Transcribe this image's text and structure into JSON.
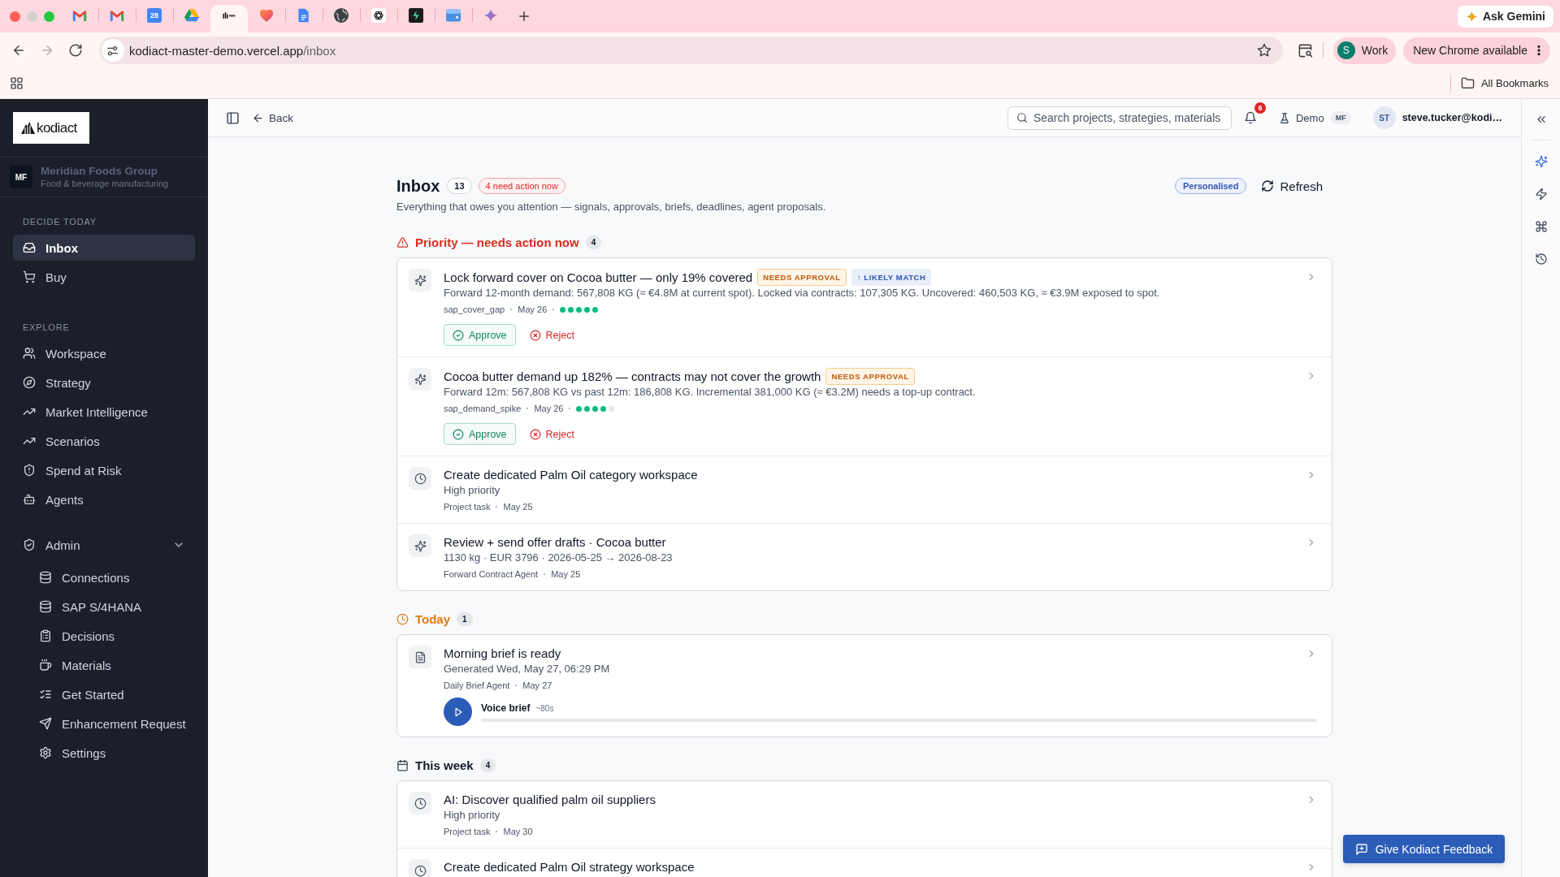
{
  "browser": {
    "tabs": [
      {
        "kind": "mail",
        "selected": false
      },
      {
        "kind": "mail",
        "selected": false
      },
      {
        "kind": "calendar",
        "date": "28",
        "selected": false
      },
      {
        "kind": "drive",
        "selected": false
      },
      {
        "kind": "kodiact",
        "selected": true
      },
      {
        "kind": "heart",
        "selected": false
      },
      {
        "kind": "doc",
        "selected": false
      },
      {
        "kind": "globe",
        "selected": false
      },
      {
        "kind": "knot",
        "selected": false
      },
      {
        "kind": "bolt",
        "selected": false
      },
      {
        "kind": "window",
        "selected": false
      },
      {
        "kind": "sparkle",
        "selected": false
      }
    ],
    "ask_button": "Ask Gemini",
    "nav": [
      {
        "kind": "back",
        "disabled": false
      },
      {
        "kind": "forward",
        "disabled": true
      },
      {
        "kind": "reload",
        "disabled": false
      }
    ],
    "address": {
      "host": "kodiact-master-demo.vercel.app",
      "path": "/inbox"
    },
    "profile": {
      "initial": "S",
      "label": "Work"
    },
    "update_button": "New Chrome available",
    "bookmarks_folder": "All Bookmarks"
  },
  "sidebar": {
    "logo": "kodiact",
    "org": {
      "initials": "MF",
      "name": "Meridian Foods Group",
      "subtitle": "Food & beverage manufacturing"
    },
    "sections": [
      {
        "label": "DECIDE TODAY",
        "items": [
          {
            "label": "Inbox",
            "kind": "inbox",
            "selected": true
          },
          {
            "label": "Buy",
            "kind": "cart",
            "selected": false
          }
        ]
      },
      {
        "label": "EXPLORE",
        "items": [
          {
            "label": "Workspace",
            "kind": "users",
            "selected": false
          },
          {
            "label": "Strategy",
            "kind": "compass",
            "selected": false
          },
          {
            "label": "Market Intelligence",
            "kind": "trending",
            "selected": false
          },
          {
            "label": "Scenarios",
            "kind": "trending",
            "selected": false
          },
          {
            "label": "Spend at Risk",
            "kind": "shieldAlert",
            "selected": false
          },
          {
            "label": "Agents",
            "kind": "bot",
            "selected": false
          }
        ]
      },
      {
        "items": [
          {
            "label": "Admin",
            "kind": "shieldCheck",
            "selected": false,
            "expanded": true,
            "children": [
              {
                "label": "Connections",
                "kind": "database",
                "selected": false
              },
              {
                "label": "SAP S/4HANA",
                "kind": "database",
                "selected": false
              },
              {
                "label": "Decisions",
                "kind": "clipboard",
                "selected": false
              },
              {
                "label": "Materials",
                "kind": "cup",
                "selected": false
              },
              {
                "label": "Get Started",
                "kind": "listChecks",
                "selected": false
              },
              {
                "label": "Enhancement Request",
                "kind": "send",
                "selected": false
              },
              {
                "label": "Settings",
                "kind": "settings",
                "selected": false
              }
            ]
          }
        ]
      }
    ]
  },
  "header": {
    "back": "Back",
    "search_placeholder": "Search projects, strategies, materials",
    "notifications": "6",
    "mode": "Demo",
    "mode_badge": "MF",
    "user_initials": "ST",
    "user_email": "steve.tucker@kodi…"
  },
  "rail": [
    {
      "kind": "sparkle",
      "selected": true
    },
    {
      "kind": "bolt",
      "selected": false
    },
    {
      "kind": "command",
      "selected": false
    },
    {
      "kind": "history",
      "selected": false
    }
  ],
  "page": {
    "title": "Inbox",
    "count": "13",
    "alert": "4 need action now",
    "subtitle": "Everything that owes you attention — signals, approvals, briefs, deadlines, agent proposals.",
    "personalised": "Personalised",
    "refresh": "Refresh"
  },
  "groups": [
    {
      "kind": "priority",
      "title": "Priority — needs action now",
      "count": "4",
      "items": [
        {
          "kind": "sparkle",
          "title": "Lock forward cover on Cocoa butter — only 19% covered",
          "badges": [
            {
              "kind": "approval",
              "text": "NEEDS APPROVAL"
            },
            {
              "kind": "match",
              "text": "↑ LIKELY MATCH"
            }
          ],
          "description": "Forward 12-month demand: 567,808 KG (≈ €4.8M at current spot). Locked via contracts: 107,305 KG. Uncovered: 460,503 KG, ≈ €3.9M exposed to spot.",
          "meta": [
            "sap_cover_gap",
            "May 26"
          ],
          "stars": 5,
          "actions": [
            {
              "kind": "approve",
              "label": "Approve"
            },
            {
              "kind": "reject",
              "label": "Reject"
            }
          ]
        },
        {
          "kind": "sparkle",
          "title": "Cocoa butter demand up 182% — contracts may not cover the growth",
          "badges": [
            {
              "kind": "approval",
              "text": "NEEDS APPROVAL"
            }
          ],
          "description": "Forward 12m: 567,808 KG vs past 12m: 186,808 KG. Incremental 381,000 KG (≈ €3.2M) needs a top-up contract.",
          "meta": [
            "sap_demand_spike",
            "May 26"
          ],
          "stars": 4,
          "actions": [
            {
              "kind": "approve",
              "label": "Approve"
            },
            {
              "kind": "reject",
              "label": "Reject"
            }
          ]
        },
        {
          "kind": "clock",
          "title": "Create dedicated Palm Oil category workspace",
          "description": "High priority",
          "meta": [
            "Project task",
            "May 25"
          ]
        },
        {
          "kind": "sparkle",
          "title": "Review + send offer drafts · Cocoa butter",
          "description": "1130 kg · EUR 3796 · 2026-05-25 → 2026-08-23",
          "meta": [
            "Forward Contract Agent",
            "May 25"
          ]
        }
      ]
    },
    {
      "kind": "today",
      "title": "Today",
      "count": "1",
      "items": [
        {
          "kind": "document",
          "title": "Morning brief is ready",
          "description": "Generated Wed, May 27, 06:29 PM",
          "meta": [
            "Daily Brief Agent",
            "May 27"
          ],
          "voice": {
            "label": "Voice brief",
            "duration": "~80s",
            "level": 0
          }
        }
      ]
    },
    {
      "kind": "week",
      "title": "This week",
      "count": "4",
      "items": [
        {
          "kind": "clock",
          "title": "AI: Discover qualified palm oil suppliers",
          "description": "High priority",
          "meta": [
            "Project task",
            "May 30"
          ]
        },
        {
          "kind": "clock",
          "title": "Create dedicated Palm Oil strategy workspace"
        }
      ]
    }
  ],
  "feedback_button": "Give Kodiact Feedback"
}
